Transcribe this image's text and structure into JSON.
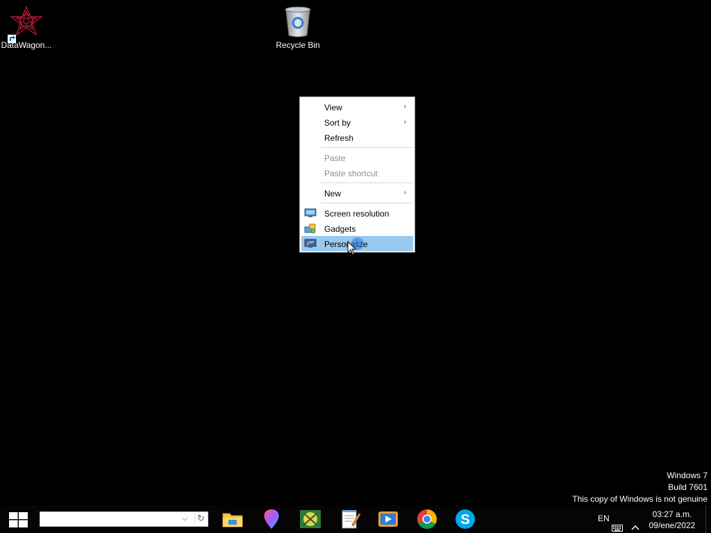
{
  "desktop": {
    "icons": [
      {
        "label": "DataWagon...",
        "icon": "datawagon-icon"
      },
      {
        "label": "Recycle Bin",
        "icon": "recycle-bin-icon"
      }
    ]
  },
  "context_menu": {
    "items": [
      {
        "label": "View",
        "submenu": true,
        "enabled": true
      },
      {
        "label": "Sort by",
        "submenu": true,
        "enabled": true
      },
      {
        "label": "Refresh",
        "submenu": false,
        "enabled": true
      },
      {
        "label": "Paste",
        "submenu": false,
        "enabled": false
      },
      {
        "label": "Paste shortcut",
        "submenu": false,
        "enabled": false
      },
      {
        "label": "New",
        "submenu": true,
        "enabled": true
      },
      {
        "label": "Screen resolution",
        "icon": "screen-resolution-icon",
        "enabled": true
      },
      {
        "label": "Gadgets",
        "icon": "gadgets-icon",
        "enabled": true
      },
      {
        "label": "Personalize",
        "icon": "personalize-icon",
        "enabled": true,
        "highlighted": true
      }
    ],
    "submenu_arrow": "›",
    "highlight_color": "#99c9ef"
  },
  "watermark": {
    "line1": "Windows 7",
    "line2": "Build 7601",
    "line3": "This copy of Windows is not genuine"
  },
  "taskbar": {
    "search": {
      "value": "",
      "placeholder": ""
    },
    "apps": [
      "file-explorer-icon",
      "maps-icon",
      "photos-icon",
      "notepad-icon",
      "media-player-icon",
      "chrome-icon",
      "skype-icon"
    ],
    "tray": {
      "language": "EN",
      "time": "03:27 a.m.",
      "date": "09/ene/2022"
    }
  }
}
